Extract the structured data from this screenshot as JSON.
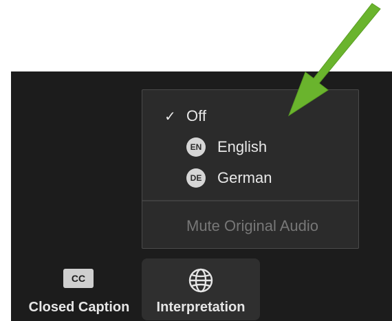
{
  "menu": {
    "items": [
      {
        "label": "Off",
        "checked": true
      },
      {
        "badge": "EN",
        "label": "English"
      },
      {
        "badge": "DE",
        "label": "German"
      }
    ],
    "mute_label": "Mute Original Audio"
  },
  "toolbar": {
    "cc_badge": "CC",
    "cc_label": "Closed Caption",
    "interp_label": "Interpretation"
  },
  "colors": {
    "toolbar_bg": "#1c1c1c",
    "menu_bg": "#2b2b2b",
    "arrow_green": "#6ab42d",
    "muted_text": "#777777"
  },
  "icons": [
    "checkmark-icon",
    "globe-icon",
    "green-arrow-annotation"
  ]
}
